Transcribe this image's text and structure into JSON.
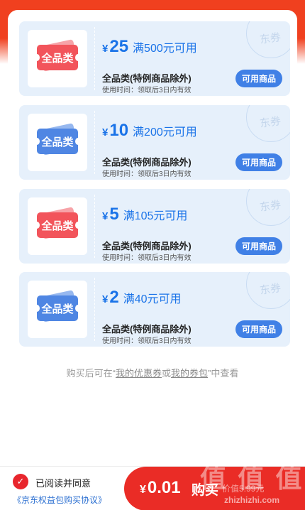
{
  "coupons": [
    {
      "badge": "全品类",
      "currency": "¥",
      "amount": "25",
      "condition": "满500元可用",
      "title": "全品类(特例商品除外)",
      "time": "使用时间：领取后3日内有效",
      "button": "可用商品",
      "stamp": "东券",
      "theme": "red"
    },
    {
      "badge": "全品类",
      "currency": "¥",
      "amount": "10",
      "condition": "满200元可用",
      "title": "全品类(特例商品除外)",
      "time": "使用时间：领取后3日内有效",
      "button": "可用商品",
      "stamp": "东券",
      "theme": "blue"
    },
    {
      "badge": "全品类",
      "currency": "¥",
      "amount": "5",
      "condition": "满105元可用",
      "title": "全品类(特例商品除外)",
      "time": "使用时间：领取后3日内有效",
      "button": "可用商品",
      "stamp": "东券",
      "theme": "red"
    },
    {
      "badge": "全品类",
      "currency": "¥",
      "amount": "2",
      "condition": "满40元可用",
      "title": "全品类(特例商品除外)",
      "time": "使用时间：领取后3日内有效",
      "button": "可用商品",
      "stamp": "东券",
      "theme": "blue"
    }
  ],
  "footnote": {
    "prefix": "购买后可在“",
    "link1": "我的优惠券",
    "middle": "或",
    "link2": "我的券包",
    "suffix": "”中查看"
  },
  "bottom": {
    "checkbox_icon": "checkmark-icon",
    "agree": "已阅读并同意",
    "agreement": "《京东权益包购买协议》",
    "currency": "¥",
    "price": "0.01",
    "buy_label": "购买",
    "original_price": "价值5.99元"
  },
  "watermark": {
    "text": "值 值 值",
    "url": "zhizhizhi.com"
  },
  "colors": {
    "accent_red": "#ea2c26",
    "coupon_blue": "#1a73e8",
    "coupon_bg": "#e6f0fb"
  }
}
